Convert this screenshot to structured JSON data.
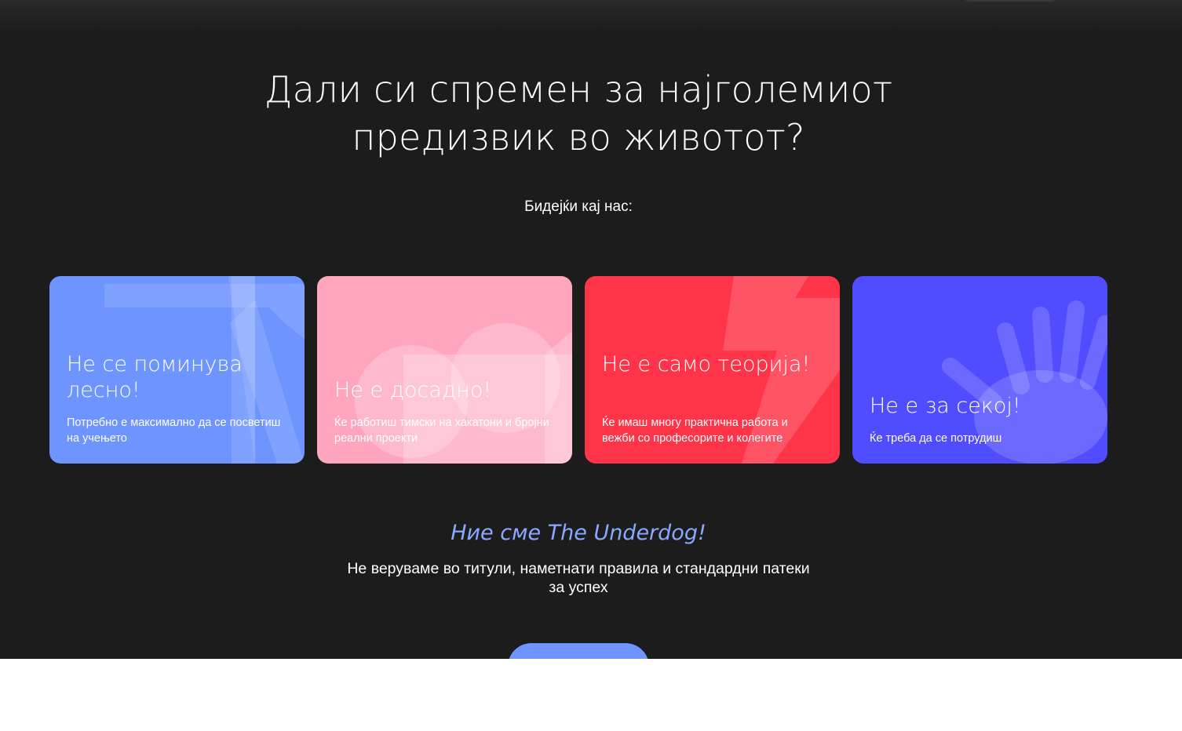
{
  "hero": {
    "title": "Дали си спремен за најголемиот предизвик во животот?",
    "subtitle": "Бидејќи кај нас:"
  },
  "cards": [
    {
      "title": "Не се поминува лесно!",
      "text": "Потребно е максимално да се посветиш на учењето",
      "color": "#6e94ff"
    },
    {
      "title": "Не е досадно!",
      "text": "Ќе работиш тимски на хакатони и бројни реални проекти",
      "color": "#ffa6be"
    },
    {
      "title": "Не е само теорија!",
      "text": "Ќе имаш многу практична работа и вежби со професорите и колегите",
      "color": "#ff3449"
    },
    {
      "title": "Не е за секој!",
      "text": "Ќе треба да се потрудиш",
      "color": "#4f4dff"
    }
  ],
  "tagline": "Ние сме The Underdog!",
  "description": "Не веруваме во титули, наметнати правила и стандардни патеки за успех",
  "colors": {
    "background": "#1c1c1d",
    "accent": "#6e94ff",
    "tagline": "#8aa8ff"
  }
}
